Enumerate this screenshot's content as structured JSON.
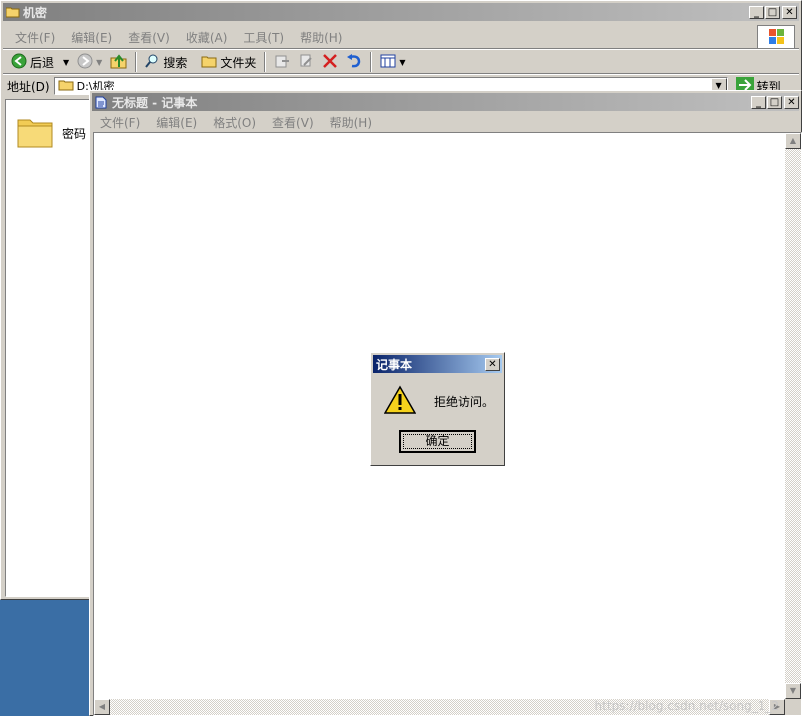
{
  "explorer": {
    "title": "机密",
    "menu": [
      "文件(F)",
      "编辑(E)",
      "查看(V)",
      "收藏(A)",
      "工具(T)",
      "帮助(H)"
    ],
    "toolbar": {
      "back_label": "后退",
      "search_label": "搜索",
      "folders_label": "文件夹"
    },
    "address": {
      "label": "地址(D)",
      "value": "D:\\机密",
      "go_label": "转到"
    },
    "items": [
      {
        "name": "密码",
        "icon": "folder-icon"
      }
    ]
  },
  "notepad": {
    "title": "无标题 - 记事本",
    "menu": [
      "文件(F)",
      "编辑(E)",
      "格式(O)",
      "查看(V)",
      "帮助(H)"
    ]
  },
  "dialog": {
    "title": "记事本",
    "message": "拒绝访问。",
    "ok_label": "确定",
    "icon": "warning-icon"
  },
  "watermark": "https://blog.csdn.net/song_1_2"
}
